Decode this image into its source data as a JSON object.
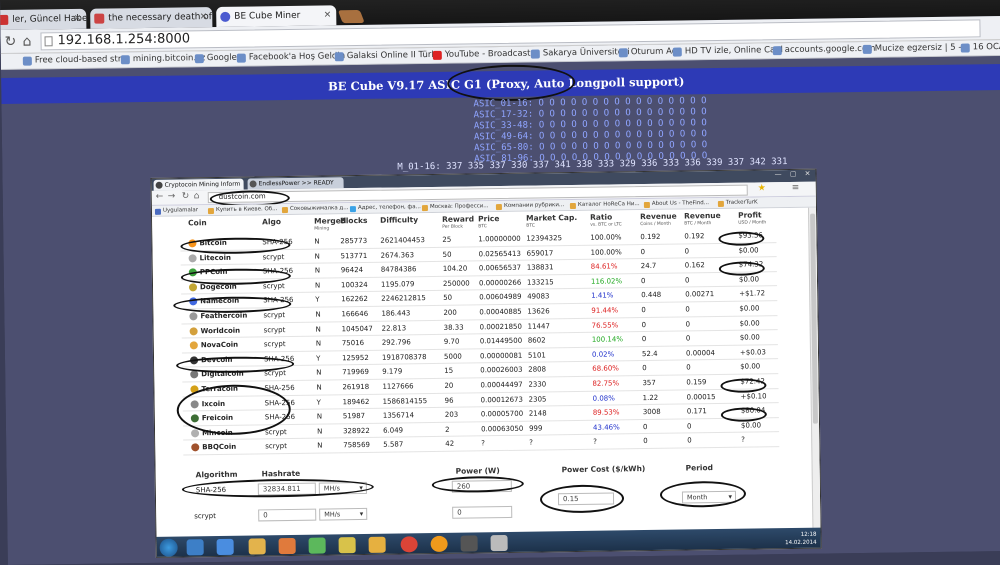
{
  "outer": {
    "tabs": [
      "ler, Güncel Haberler, G",
      "the necessary death of char",
      "BE Cube Miner"
    ],
    "address": "192.168.1.254:8000",
    "bookmarks": [
      "Free cloud-based stra",
      "mining.bitcoin.cz",
      "Google",
      "Facebook'a Hoş Geldin",
      "Galaksi Online II Türkç",
      "YouTube - Broadcast y",
      "Sakarya Üniversitesi",
      "Oturum Aç",
      "HD TV izle, Online Canl",
      "accounts.google.com",
      "Mucize egzersiz | 5 -",
      "16 OCAK"
    ]
  },
  "banner": "BE Cube V9.17 ASIC G1 (Proxy, Auto Longpoll support)",
  "asic_rows": [
    "ASIC_01-16: O O O O O O O O O O O O O O O O",
    "ASIC_17-32: O O O O O O O O O O O O O O O O",
    "ASIC_33-48: O O O O O O O O O O O O O O O O",
    "ASIC_49-64: O O O O O O O O O O O O O O O O",
    "ASIC_65-80: O O O O O O O O O O O O O O O O",
    "ASIC_81-96: O O O O O O O O O O O O O O O O"
  ],
  "m_line": "M_01-16: 337 335 337 330 337 341 338 333 329 336 333 336 339 337 342 331",
  "inner": {
    "tabs": [
      "Cryptocoin Mining Inform",
      "EndlessPower >> READY"
    ],
    "window_controls": "— ▢ ✕",
    "address": "dustcoin.com",
    "bookmarks": [
      "Uygulamalar",
      "Купить в Киеве. Об...",
      "Соковыжималка д...",
      "Адрес, телефон, фа...",
      "Москва: Професси...",
      "Компании рубрики...",
      "Каталог HoReCa Ни...",
      "About Us - TheFind...",
      "TrackerTurK"
    ]
  },
  "table": {
    "headers": [
      "Coin",
      "Algo",
      "Merged",
      "Blocks",
      "Difficulty",
      "Reward",
      "Price",
      "Market Cap.",
      "Ratio",
      "Revenue",
      "Revenue",
      "Profit"
    ],
    "subheaders": [
      "",
      "",
      "Mining",
      "",
      "",
      "Per Block",
      "BTC",
      "BTC",
      "vs. BTC or LTC",
      "Coins / Month",
      "BTC / Month",
      "USD / Month"
    ],
    "rows": [
      [
        "Bitcoin",
        "SHA-256",
        "N",
        "285773",
        "2621404453",
        "25",
        "1.00000000",
        "12394325",
        "100.00%",
        "0.192",
        "0.192",
        "$93.36"
      ],
      [
        "Litecoin",
        "scrypt",
        "N",
        "513771",
        "2674.363",
        "50",
        "0.02565413",
        "659017",
        "100.00%",
        "0",
        "0",
        "$0.00"
      ],
      [
        "PPCoin",
        "SHA-256",
        "N",
        "96424",
        "84784386",
        "104.20",
        "0.00656537",
        "138831",
        "84.61%",
        "24.7",
        "0.162",
        "$74.32"
      ],
      [
        "Dogecoin",
        "scrypt",
        "N",
        "100324",
        "1195.079",
        "250000",
        "0.00000266",
        "133215",
        "116.02%",
        "0",
        "0",
        "$0.00"
      ],
      [
        "Namecoin",
        "SHA-256",
        "Y",
        "162262",
        "2246212815",
        "50",
        "0.00604989",
        "49083",
        "1.41%",
        "0.448",
        "0.00271",
        "+$1.72"
      ],
      [
        "Feathercoin",
        "scrypt",
        "N",
        "166646",
        "186.443",
        "200",
        "0.00040885",
        "13626",
        "91.44%",
        "0",
        "0",
        "$0.00"
      ],
      [
        "Worldcoin",
        "scrypt",
        "N",
        "1045047",
        "22.813",
        "38.33",
        "0.00021850",
        "11447",
        "76.55%",
        "0",
        "0",
        "$0.00"
      ],
      [
        "NovaCoin",
        "scrypt",
        "N",
        "75016",
        "292.796",
        "9.70",
        "0.01449500",
        "8602",
        "100.14%",
        "0",
        "0",
        "$0.00"
      ],
      [
        "Devcoin",
        "SHA-256",
        "Y",
        "125952",
        "1918708378",
        "5000",
        "0.00000081",
        "5101",
        "0.02%",
        "52.4",
        "0.00004",
        "+$0.03"
      ],
      [
        "Digitalcoin",
        "scrypt",
        "N",
        "719969",
        "9.179",
        "15",
        "0.00026003",
        "2808",
        "68.60%",
        "0",
        "0",
        "$0.00"
      ],
      [
        "Terracoin",
        "SHA-256",
        "N",
        "261918",
        "1127666",
        "20",
        "0.00044497",
        "2330",
        "82.75%",
        "357",
        "0.159",
        "$72.42"
      ],
      [
        "Ixcoin",
        "SHA-256",
        "Y",
        "189462",
        "1586814155",
        "96",
        "0.00012673",
        "2305",
        "0.08%",
        "1.22",
        "0.00015",
        "+$0.10"
      ],
      [
        "Freicoin",
        "SHA-256",
        "N",
        "51987",
        "1356714",
        "203",
        "0.00005700",
        "2148",
        "89.53%",
        "3008",
        "0.171",
        "$80.04"
      ],
      [
        "Mincoin",
        "scrypt",
        "N",
        "328922",
        "6.049",
        "2",
        "0.00063050",
        "999",
        "43.46%",
        "0",
        "0",
        "$0.00"
      ],
      [
        "BBQCoin",
        "scrypt",
        "N",
        "758569",
        "5.587",
        "42",
        "?",
        "?",
        "?",
        "0",
        "0",
        "?"
      ]
    ]
  },
  "form": {
    "algorithm_label": "Algorithm",
    "hashrate_label": "Hashrate",
    "power_label": "Power (W)",
    "power_cost_label": "Power Cost ($/kWh)",
    "period_label": "Period",
    "sha_label": "SHA-256",
    "sha_hashrate": "32834.811",
    "sha_unit": "MH/s",
    "sha_power": "260",
    "scrypt_label": "scrypt",
    "scrypt_hashrate": "0",
    "scrypt_unit": "MH/s",
    "scrypt_power": "0",
    "power_cost": "0.15",
    "period": "Month"
  },
  "tray": {
    "time": "12:18",
    "date": "14.02.2014"
  }
}
